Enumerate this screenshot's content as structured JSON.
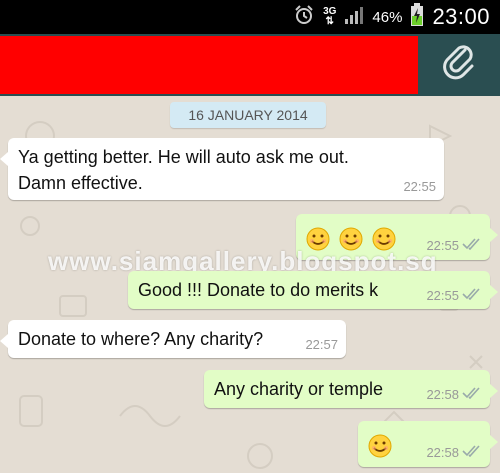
{
  "status_bar": {
    "network": "3G",
    "battery": "46%",
    "time": "23:00",
    "icons": [
      "alarm-icon",
      "signal-icon",
      "battery-charging-icon"
    ]
  },
  "header": {
    "attach_icon": "paperclip-icon"
  },
  "chat": {
    "date": "16 JANUARY 2014",
    "watermark": "www.siamgallery.blogspot.sg",
    "messages": [
      {
        "dir": "in",
        "lines": [
          "Ya getting better. He will auto ask me out.",
          "Damn effective."
        ],
        "time": "22:55"
      },
      {
        "dir": "out",
        "emoji_count": 3,
        "time": "22:55",
        "status": "read"
      },
      {
        "dir": "out",
        "text": "Good !!! Donate to do merits k",
        "time": "22:55",
        "status": "read"
      },
      {
        "dir": "in",
        "text": "Donate to where? Any charity?",
        "time": "22:57"
      },
      {
        "dir": "out",
        "text": "Any charity or temple",
        "time": "22:58",
        "status": "read"
      },
      {
        "dir": "out",
        "emoji_count": 1,
        "time": "22:58",
        "status": "read"
      }
    ]
  },
  "colors": {
    "header_bg": "#2a4e51",
    "redaction": "#ff0000",
    "outgoing_bubble": "#e2fdc6",
    "incoming_bubble": "#ffffff",
    "date_pill": "#d4eaf4"
  }
}
